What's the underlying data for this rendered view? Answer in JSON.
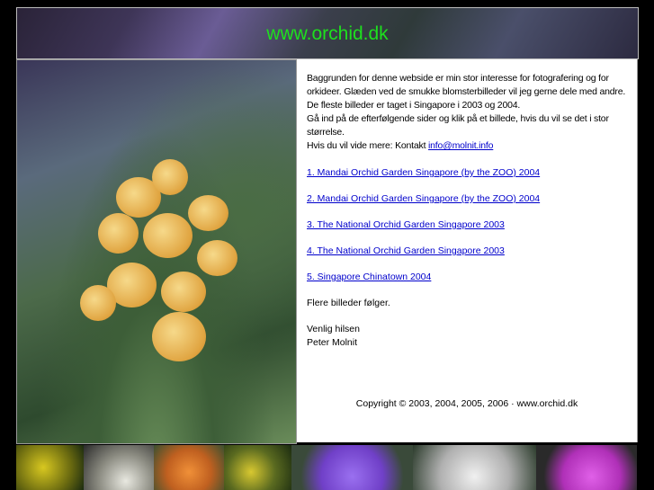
{
  "header": {
    "title": "www.orchid.dk"
  },
  "intro": {
    "lines": [
      "Baggrunden for denne webside er min stor interesse for fotografering og for orkideer. Glæden ved de smukke blomsterbilleder vil jeg gerne dele med andre.",
      "De fleste billeder er taget i Singapore i 2003 og 2004.",
      "Gå ind på de efterfølgende sider og klik på et billede, hvis du vil se det i stor størrelse."
    ],
    "contact_prefix": "Hvis du vil vide mere: Kontakt ",
    "contact_email": "info@molnit.info"
  },
  "galleries": [
    {
      "label": "1. Mandai Orchid Garden Singapore (by the ZOO) 2004"
    },
    {
      "label": "2. Mandai Orchid Garden Singapore (by the ZOO) 2004"
    },
    {
      "label": "3. The National Orchid Garden Singapore 2003"
    },
    {
      "label": "4. The National Orchid Garden Singapore 2003"
    },
    {
      "label": "5. Singapore Chinatown 2004"
    }
  ],
  "more_text": "Flere billeder følger.",
  "greeting": "Venlig hilsen",
  "signature": "Peter Molnit",
  "copyright": "Copyright © 2003, 2004, 2005, 2006 · www.orchid.dk",
  "thumbnails": [
    {
      "color": "#c8b81a"
    },
    {
      "color": "#b8b8b0"
    },
    {
      "color": "#e8802a"
    },
    {
      "color": "#9a9a2a"
    },
    {
      "color": "#8a60e0"
    },
    {
      "color": "#d8d8d8"
    },
    {
      "color": "#d050d8"
    }
  ]
}
